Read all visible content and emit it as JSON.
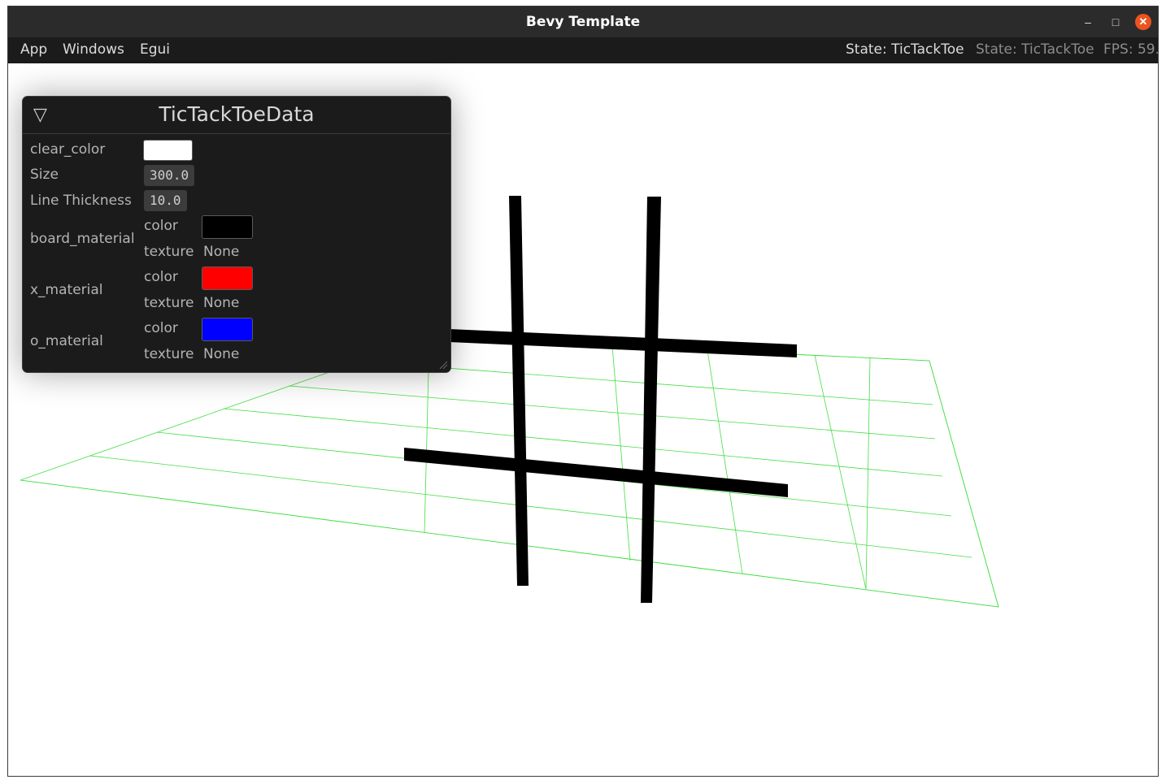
{
  "window": {
    "title": "Bevy Template"
  },
  "menu": {
    "items": [
      "App",
      "Windows",
      "Egui"
    ],
    "status": [
      "State: TicTackToe",
      "State: TicTackToe",
      "FPS: 59."
    ]
  },
  "inspector": {
    "title": "TicTackToeData",
    "clear_color": {
      "label": "clear_color",
      "color": "#ffffff"
    },
    "size": {
      "label": "Size",
      "value": "300.0"
    },
    "line_thickness": {
      "label": "Line Thickness",
      "value": "10.0"
    },
    "board_material": {
      "label": "board_material",
      "color_label": "color",
      "color": "#000000",
      "texture_label": "texture",
      "texture": "None"
    },
    "x_material": {
      "label": "x_material",
      "color_label": "color",
      "color": "#ff0000",
      "texture_label": "texture",
      "texture": "None"
    },
    "o_material": {
      "label": "o_material",
      "color_label": "color",
      "color": "#0000ff",
      "texture_label": "texture",
      "texture": "None"
    }
  },
  "colors": {
    "grid": "#44dd44",
    "board": "#000000",
    "titlebar": "#2b2b2b",
    "menubar": "#1b1b1b",
    "close": "#e95420"
  },
  "icons": {
    "minimize": "minimize-icon",
    "maximize": "maximize-icon",
    "close": "close-icon",
    "collapse": "collapse-triangle-icon"
  }
}
